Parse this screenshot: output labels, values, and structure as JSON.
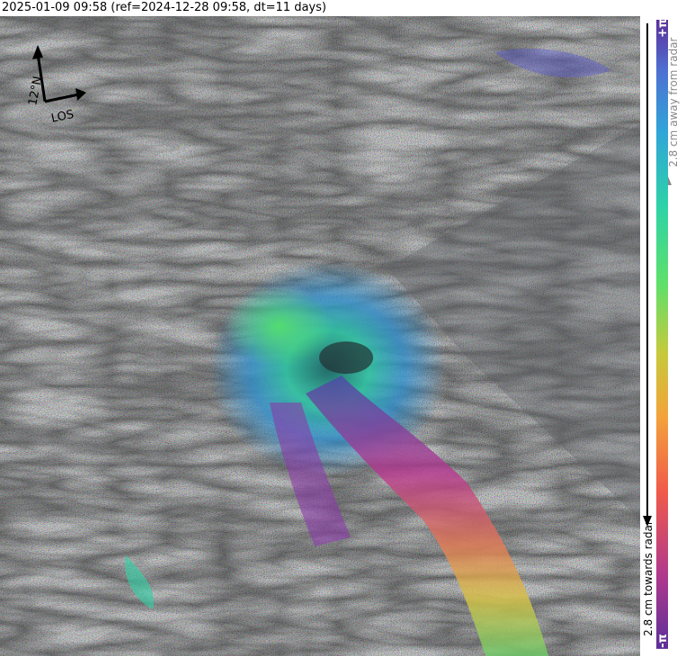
{
  "header": {
    "title": "2025-01-09 09:58 (ref=2024-12-28 09:58, dt=11 days)"
  },
  "compass": {
    "north_label": "12°N",
    "los_label": "LOS",
    "north_icon": "north-arrow-icon",
    "los_icon": "los-arrow-icon"
  },
  "colorbar": {
    "top_label": "+π",
    "bottom_label": "-π",
    "away_label": "2.8 cm away from radar",
    "towards_label": "2.8 cm towards radar",
    "colors": [
      "#5b2f99",
      "#b23a8c",
      "#f05a4a",
      "#f3a33a",
      "#c6c93b",
      "#5ee06a",
      "#2ed3a6",
      "#2fa6d8",
      "#4f6fd2",
      "#5b2f99"
    ],
    "away_arrow_color": "#888888",
    "towards_arrow_color": "#000000"
  },
  "image": {
    "description_icon": "interferogram-image"
  }
}
